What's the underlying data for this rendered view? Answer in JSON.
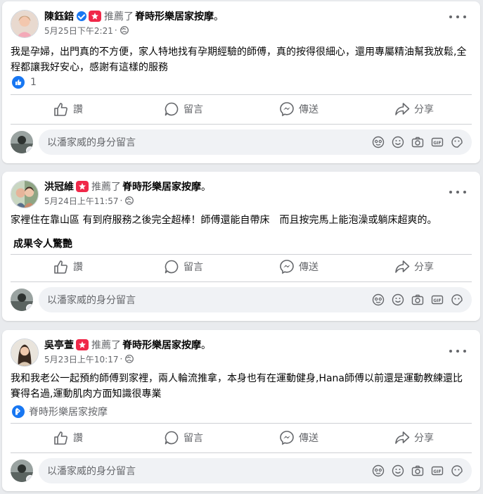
{
  "recommend_verb": "推薦了",
  "page_name": "脊時形樂居家按摩",
  "page_suffix": "。",
  "comment_placeholder": "以潘家威的身分留言",
  "actions": {
    "like": "讚",
    "comment": "留言",
    "send": "傳送",
    "share": "分享"
  },
  "posts": [
    {
      "author": "陳鈺錇",
      "verified": true,
      "time": "5月25日下午2:21",
      "dot": "·",
      "text": "我是孕婦，出門真的不方便，家人特地找有孕期經驗的師傅，真的按得很細心，還用專屬精油幫我放鬆,全程都讓我好安心，感謝有這樣的服務",
      "reaction_count": "1"
    },
    {
      "author": "洪冠維",
      "verified": false,
      "time": "5月24日上午11:57",
      "dot": "·",
      "text": "家裡住在靠山區 有到府服務之後完全超棒！師傅還能自帶床　而且按完馬上能泡澡或躺床超爽的。",
      "extra": "成果令人驚艷"
    },
    {
      "author": "吳亭萱",
      "verified": false,
      "time": "5月23日上午10:17",
      "dot": "·",
      "text": "我和我老公一起預約師傅到家裡，兩人輪流推拿，本身也有在運動健身,Hana師傅以前還是運動教練還比賽得名過,運動肌肉方面知識很專業",
      "page_tag": "脊時形樂居家按摩"
    }
  ],
  "colors": {
    "accent": "#1877f2",
    "badge_red": "#f02849",
    "muted": "#65676b",
    "background": "#e9ebee"
  }
}
